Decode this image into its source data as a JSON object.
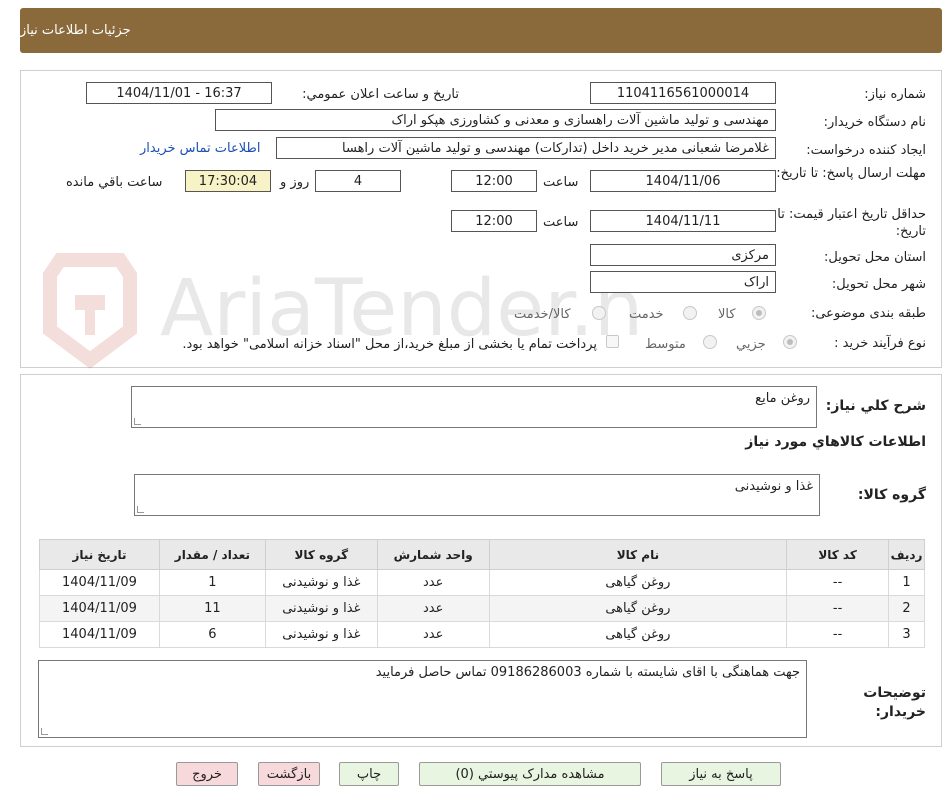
{
  "header": {
    "title": "جزئیات اطلاعات نیاز"
  },
  "watermark": {
    "text": "AriaTender.neT"
  },
  "info": {
    "need_number_label": "شماره نیاز:",
    "need_number": "1104116561000014",
    "announce_label": "تاریخ و ساعت اعلان عمومي:",
    "announce_value": "1404/11/01 - 16:37",
    "buyer_label": "نام دستگاه خریدار:",
    "buyer_value": "مهندسی و تولید ماشین آلات راهسازی و معدنی و کشاورزی هپکو اراک",
    "creator_label": "ايجاد کننده درخواست:",
    "creator_value": "غلامرضا شعبانی مدیر خرید داخل (تداركات) مهندسی و تولید ماشین آلات راهسا",
    "contact_link": "اطلاعات تماس خریدار",
    "send_deadline_label": "مهلت ارسال پاسخ: تا تاریخ:",
    "send_date": "1404/11/06",
    "time_label": "ساعت",
    "send_time": "12:00",
    "days_value": "4",
    "days_label": "روز و",
    "remaining_time": "17:30:04",
    "remaining_label": "ساعت باقي مانده",
    "validity_label": "حداقل تاریخ اعتبار قیمت: تا تاریخ:",
    "validity_date": "1404/11/11",
    "validity_time": "12:00",
    "province_label": "استان محل تحویل:",
    "province_value": "مرکزی",
    "city_label": "شهر محل تحویل:",
    "city_value": "اراک",
    "category_label": "طبقه بندی موضوعی:",
    "category_options": [
      "کالا",
      "خدمت",
      "کالا/خدمت"
    ],
    "process_label": "نوع فرآیند خرید :",
    "process_options": [
      "جزیي",
      "متوسط"
    ],
    "payment_note": "پرداخت تمام یا بخشی از مبلغ خرید،از محل \"اسناد خزانه اسلامی\" خواهد بود."
  },
  "details": {
    "summary_label": "شرح كلي نياز:",
    "summary_value": "روغن مایع",
    "goods_info_title": "اطلاعات کالاهاي مورد نياز",
    "group_label": "گروه کالا:",
    "group_value": "غذا و نوشیدنی",
    "table": {
      "headers": [
        "رديف",
        "کد کالا",
        "نام کالا",
        "واحد شمارش",
        "گروه کالا",
        "تعداد / مقدار",
        "تاريخ نياز"
      ],
      "rows": [
        [
          "1",
          "--",
          "روغن گیاهی",
          "عدد",
          "غذا و نوشیدنی",
          "1",
          "1404/11/09"
        ],
        [
          "2",
          "--",
          "روغن گیاهی",
          "عدد",
          "غذا و نوشیدنی",
          "11",
          "1404/11/09"
        ],
        [
          "3",
          "--",
          "روغن گیاهی",
          "عدد",
          "غذا و نوشیدنی",
          "6",
          "1404/11/09"
        ]
      ]
    },
    "buyer_notes_label": "توضیحات خریدار:",
    "buyer_notes_value": "جهت هماهنگی با اقای شایسته با شماره 09186286003 تماس حاصل فرمایید"
  },
  "buttons": {
    "reply": "پاسخ به نياز",
    "attachments": "مشاهده مدارک پيوستي (0)",
    "print": "چاپ",
    "back": "بازگشت",
    "exit": "خروج"
  }
}
